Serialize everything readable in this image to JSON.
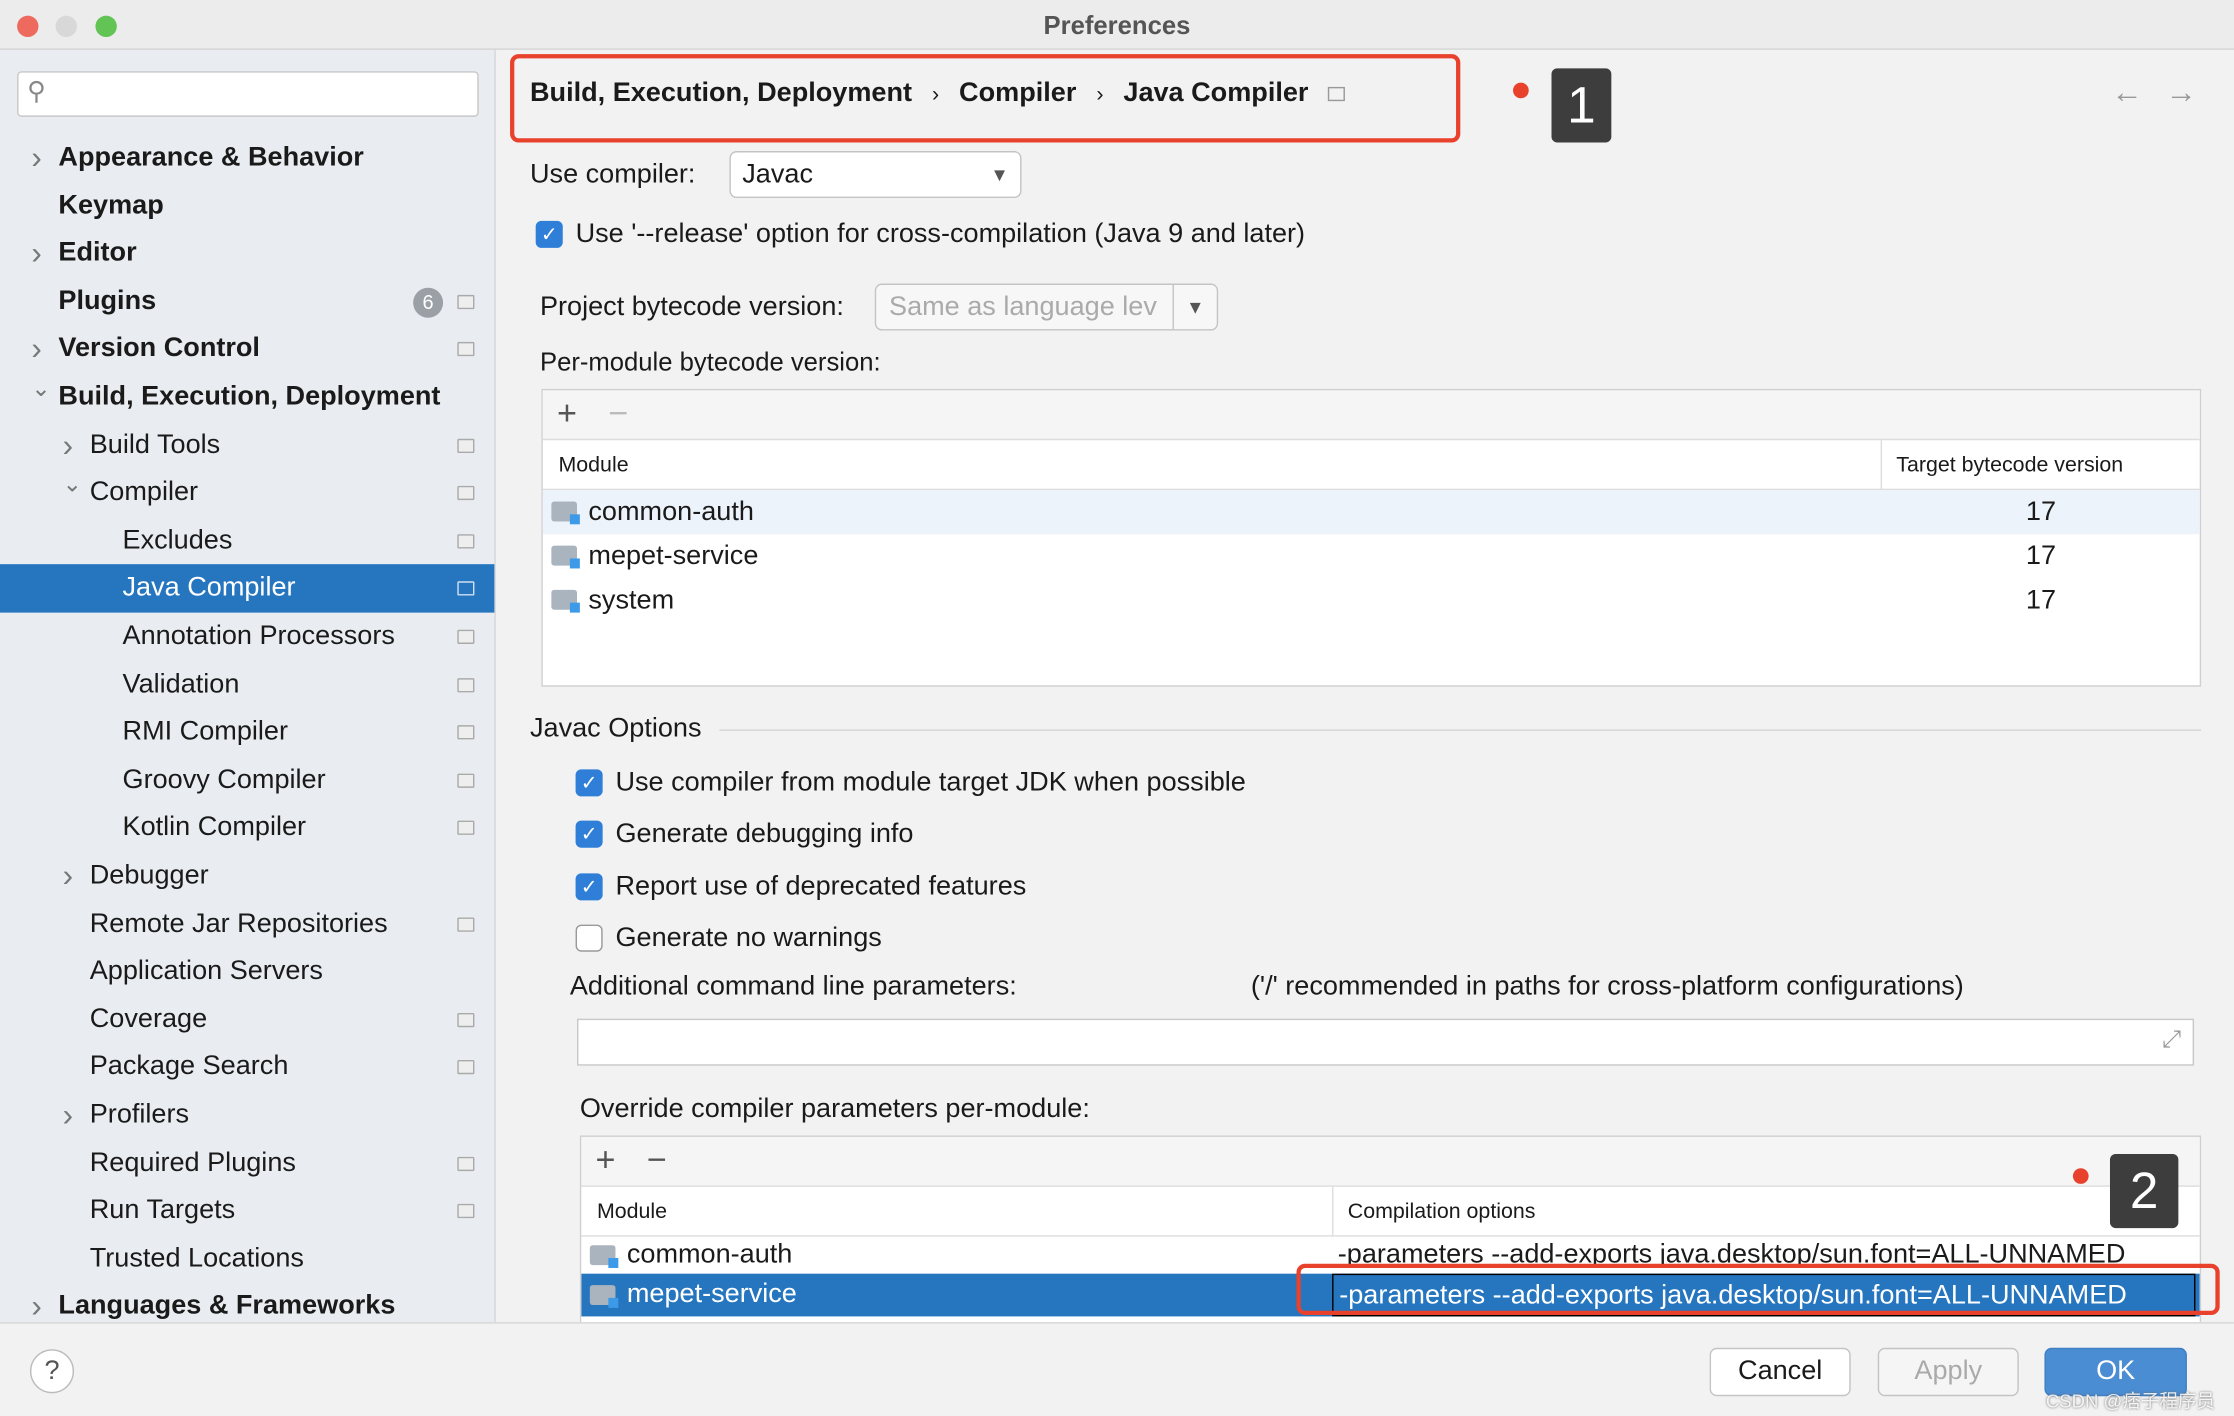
{
  "window": {
    "title": "Preferences"
  },
  "sidebar": {
    "search_placeholder": "",
    "items": [
      {
        "label": "Appearance & Behavior",
        "level": 0,
        "arrow": "right",
        "bold": true
      },
      {
        "label": "Keymap",
        "level": 0,
        "bold": true
      },
      {
        "label": "Editor",
        "level": 0,
        "arrow": "right",
        "bold": true
      },
      {
        "label": "Plugins",
        "level": 0,
        "bold": true,
        "badge": "6",
        "page": true
      },
      {
        "label": "Version Control",
        "level": 0,
        "arrow": "right",
        "bold": true,
        "page": true
      },
      {
        "label": "Build, Execution, Deployment",
        "level": 0,
        "arrow": "down",
        "bold": true
      },
      {
        "label": "Build Tools",
        "level": 1,
        "arrow": "right",
        "page": true
      },
      {
        "label": "Compiler",
        "level": 1,
        "arrow": "down",
        "page": true
      },
      {
        "label": "Excludes",
        "level": 2,
        "page": true
      },
      {
        "label": "Java Compiler",
        "level": 2,
        "page": true,
        "selected": true
      },
      {
        "label": "Annotation Processors",
        "level": 2,
        "page": true
      },
      {
        "label": "Validation",
        "level": 2,
        "page": true
      },
      {
        "label": "RMI Compiler",
        "level": 2,
        "page": true
      },
      {
        "label": "Groovy Compiler",
        "level": 2,
        "page": true
      },
      {
        "label": "Kotlin Compiler",
        "level": 2,
        "page": true
      },
      {
        "label": "Debugger",
        "level": 1,
        "arrow": "right"
      },
      {
        "label": "Remote Jar Repositories",
        "level": 1,
        "page": true
      },
      {
        "label": "Application Servers",
        "level": 1
      },
      {
        "label": "Coverage",
        "level": 1,
        "page": true
      },
      {
        "label": "Package Search",
        "level": 1,
        "page": true
      },
      {
        "label": "Profilers",
        "level": 1,
        "arrow": "right"
      },
      {
        "label": "Required Plugins",
        "level": 1,
        "page": true
      },
      {
        "label": "Run Targets",
        "level": 1,
        "page": true
      },
      {
        "label": "Trusted Locations",
        "level": 1
      },
      {
        "label": "Languages & Frameworks",
        "level": 0,
        "arrow": "right",
        "bold": true
      }
    ]
  },
  "breadcrumb": [
    "Build, Execution, Deployment",
    "Compiler",
    "Java Compiler"
  ],
  "annotations": [
    "1",
    "2"
  ],
  "main": {
    "use_compiler_label": "Use compiler:",
    "use_compiler_value": "Javac",
    "release_option": {
      "label": "Use '--release' option for cross-compilation (Java 9 and later)",
      "checked": true
    },
    "project_bytecode_label": "Project bytecode version:",
    "project_bytecode_value": "Same as language lev",
    "per_module_label": "Per-module bytecode version:",
    "per_module_table": {
      "columns": [
        "Module",
        "Target bytecode version"
      ],
      "rows": [
        [
          "common-auth",
          "17"
        ],
        [
          "mepet-service",
          "17"
        ],
        [
          "system",
          "17"
        ]
      ]
    },
    "javac_options_title": "Javac Options",
    "javac_checkboxes": [
      {
        "label": "Use compiler from module target JDK when possible",
        "checked": true
      },
      {
        "label": "Generate debugging info",
        "checked": true
      },
      {
        "label": "Report use of deprecated features",
        "checked": true
      },
      {
        "label": "Generate no warnings",
        "checked": false
      }
    ],
    "additional_params_label": "Additional command line parameters:",
    "additional_params_hint": "('/' recommended in paths for cross-platform configurations)",
    "additional_params_value": "",
    "override_label": "Override compiler parameters per-module:",
    "override_table": {
      "columns": [
        "Module",
        "Compilation options"
      ],
      "rows": [
        [
          "common-auth",
          "-parameters --add-exports java.desktop/sun.font=ALL-UNNAMED"
        ],
        [
          "mepet-service",
          "-parameters --add-exports java.desktop/sun.font=ALL-UNNAMED"
        ]
      ],
      "selected_row": 1
    }
  },
  "footer": {
    "help": "?",
    "cancel": "Cancel",
    "apply": "Apply",
    "ok": "OK"
  },
  "watermark": "CSDN @痞子程序员",
  "colors": {
    "selection": "#2675bf",
    "annotation_red": "#e8412c",
    "accent": "#2f7fd9"
  }
}
